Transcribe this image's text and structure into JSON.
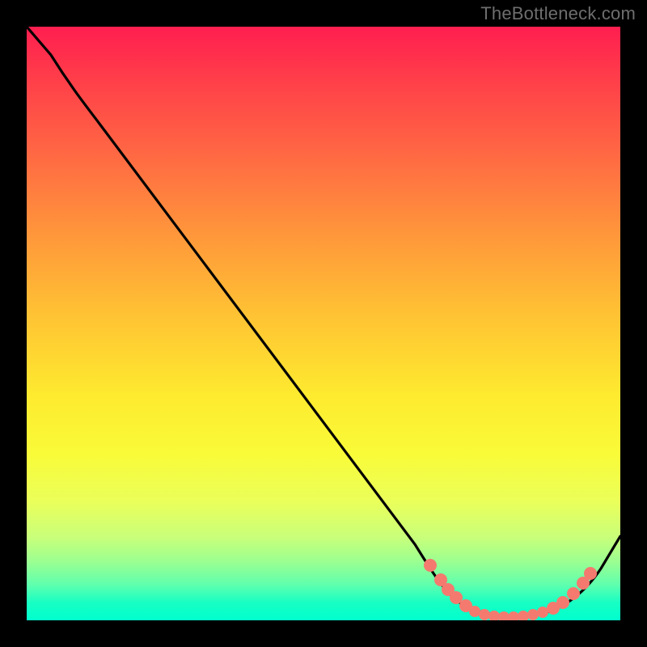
{
  "watermark": "TheBottleneck.com",
  "chart_data": {
    "type": "line",
    "title": "",
    "xlabel": "",
    "ylabel": "",
    "xlim": [
      0,
      100
    ],
    "ylim": [
      0,
      100
    ],
    "background_gradient": [
      "#ff1e50",
      "#ff6a43",
      "#ffc733",
      "#f9fb38",
      "#9dff90",
      "#00ffce"
    ],
    "series": [
      {
        "name": "bottleneck-curve",
        "color": "#000000",
        "x": [
          0,
          4,
          12,
          65,
          74,
          81,
          87,
          94,
          100
        ],
        "y": [
          100,
          95,
          84,
          13,
          4,
          1,
          1,
          6,
          14
        ]
      }
    ],
    "highlighted_points": {
      "name": "optimal-range-dots",
      "color": "#f47a6f",
      "x": [
        68,
        70,
        71,
        72,
        74,
        75,
        77,
        79,
        80,
        82,
        84,
        85,
        87,
        89,
        90,
        92,
        94,
        95
      ],
      "y": [
        9,
        7,
        5,
        4,
        2,
        1,
        1,
        0,
        0,
        0,
        0,
        0,
        1,
        2,
        3,
        4,
        6,
        8
      ]
    }
  }
}
